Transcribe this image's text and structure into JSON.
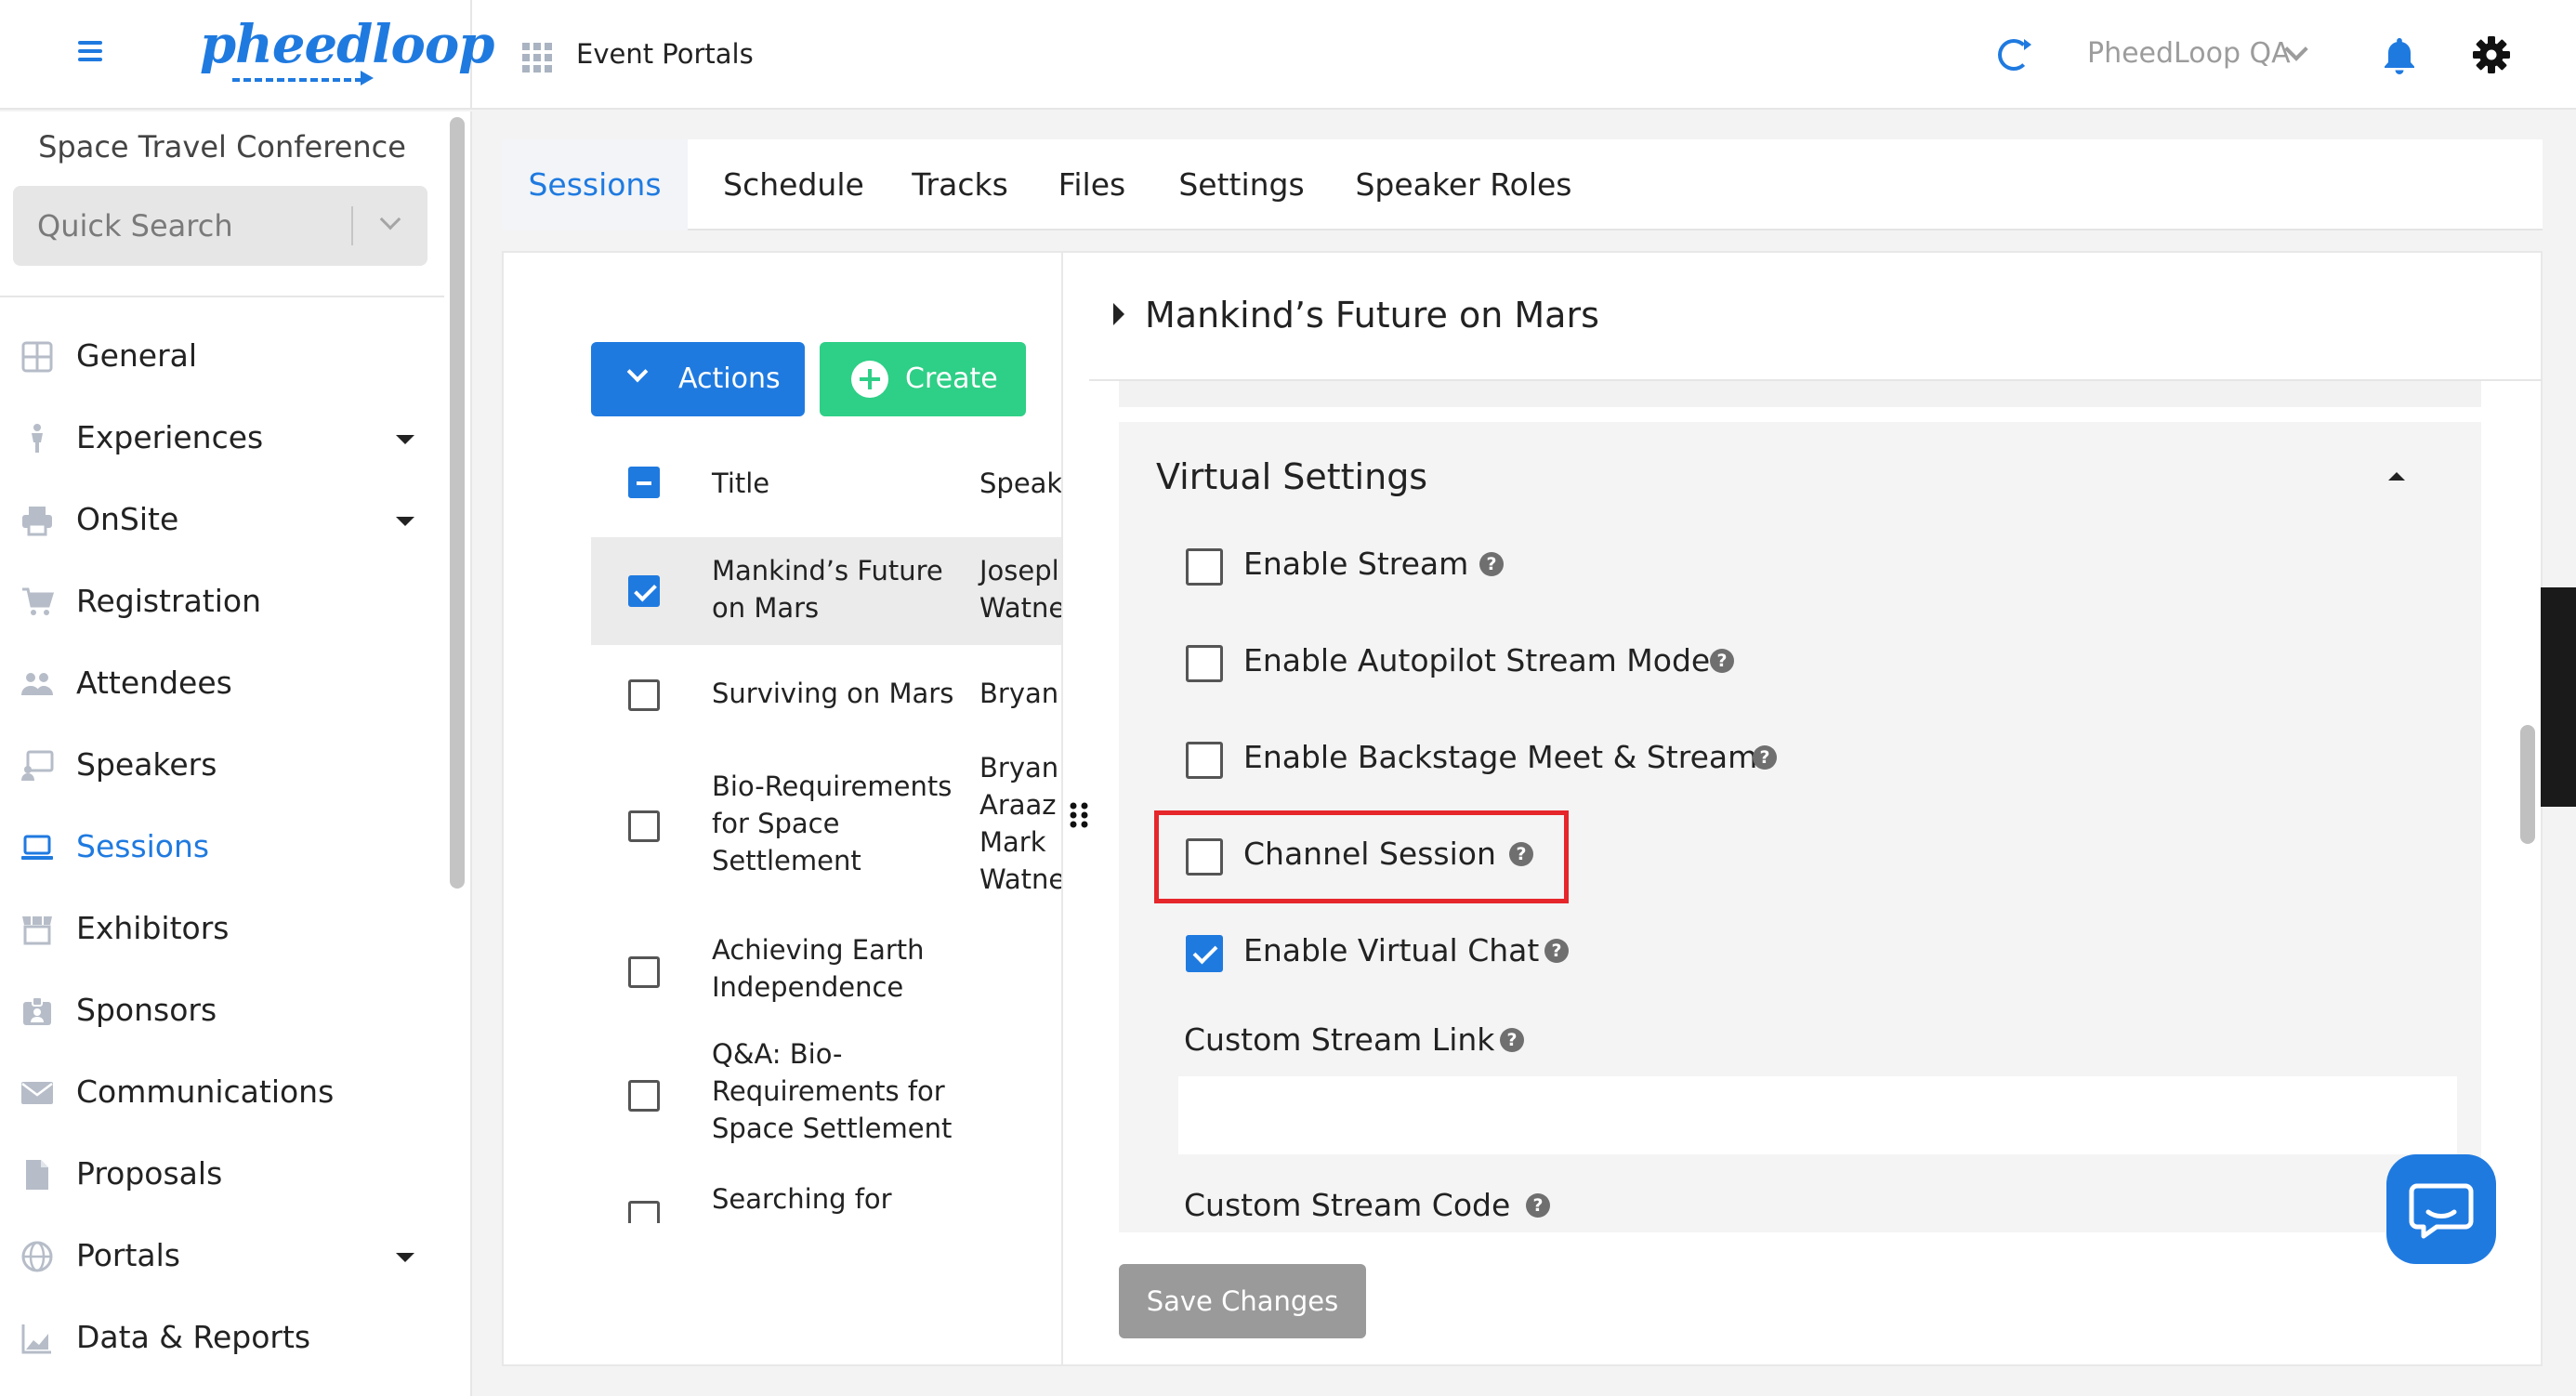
{
  "topbar": {
    "logo_text": "pheedloop",
    "app_section": "Event Portals",
    "organization": "PheedLoop QA"
  },
  "sidebar": {
    "event_name": "Space Travel Conference",
    "search_placeholder": "Quick Search",
    "items": [
      {
        "label": "General",
        "icon": "grid-icon",
        "has_submenu": false
      },
      {
        "label": "Experiences",
        "icon": "person-icon",
        "has_submenu": true
      },
      {
        "label": "OnSite",
        "icon": "printer-icon",
        "has_submenu": true
      },
      {
        "label": "Registration",
        "icon": "cart-icon",
        "has_submenu": false
      },
      {
        "label": "Attendees",
        "icon": "people-icon",
        "has_submenu": false
      },
      {
        "label": "Speakers",
        "icon": "presenter-icon",
        "has_submenu": false
      },
      {
        "label": "Sessions",
        "icon": "laptop-icon",
        "has_submenu": false,
        "active": true
      },
      {
        "label": "Exhibitors",
        "icon": "storefront-icon",
        "has_submenu": false
      },
      {
        "label": "Sponsors",
        "icon": "badge-icon",
        "has_submenu": false
      },
      {
        "label": "Communications",
        "icon": "envelope-icon",
        "has_submenu": false
      },
      {
        "label": "Proposals",
        "icon": "document-icon",
        "has_submenu": false
      },
      {
        "label": "Portals",
        "icon": "globe-icon",
        "has_submenu": true
      },
      {
        "label": "Data & Reports",
        "icon": "bar-chart-icon",
        "has_submenu": false
      }
    ]
  },
  "tabs": [
    "Sessions",
    "Schedule",
    "Tracks",
    "Files",
    "Settings",
    "Speaker Roles"
  ],
  "list": {
    "actions_label": "Actions",
    "create_label": "Create",
    "columns": [
      "Title",
      "Speak"
    ],
    "rows": [
      {
        "title": "Mankind’s Future on Mars",
        "speaker": "Josepl Watne",
        "checked": true
      },
      {
        "title": "Surviving on Mars",
        "speaker": "Bryan",
        "checked": false
      },
      {
        "title": "Bio-Requirements for Space Settlement",
        "speaker": "Bryan Araaz Mark Watne",
        "checked": false
      },
      {
        "title": "Achieving Earth Independence",
        "speaker": "",
        "checked": false
      },
      {
        "title": "Q&A: Bio-Requirements for Space Settlement",
        "speaker": "",
        "checked": false
      },
      {
        "title": "Searching for",
        "speaker": "",
        "checked": false
      }
    ]
  },
  "detail": {
    "session_title": "Mankind’s Future on Mars",
    "section_title": "Virtual Settings",
    "options": [
      {
        "label": "Enable Stream",
        "checked": false
      },
      {
        "label": "Enable Autopilot Stream Mode",
        "checked": false
      },
      {
        "label": "Enable Backstage Meet & Stream",
        "checked": false
      },
      {
        "label": "Channel Session",
        "checked": false,
        "highlighted": true
      },
      {
        "label": "Enable Virtual Chat",
        "checked": true
      }
    ],
    "custom_stream_link_label": "Custom Stream Link",
    "custom_stream_link_value": "",
    "custom_stream_code_label": "Custom Stream Code",
    "save_label": "Save Changes"
  },
  "colors": {
    "primary": "#1f7ae0",
    "create_green": "#2ecf86",
    "highlight_red": "#e5262b",
    "save_disabled": "#9a9a9a"
  }
}
